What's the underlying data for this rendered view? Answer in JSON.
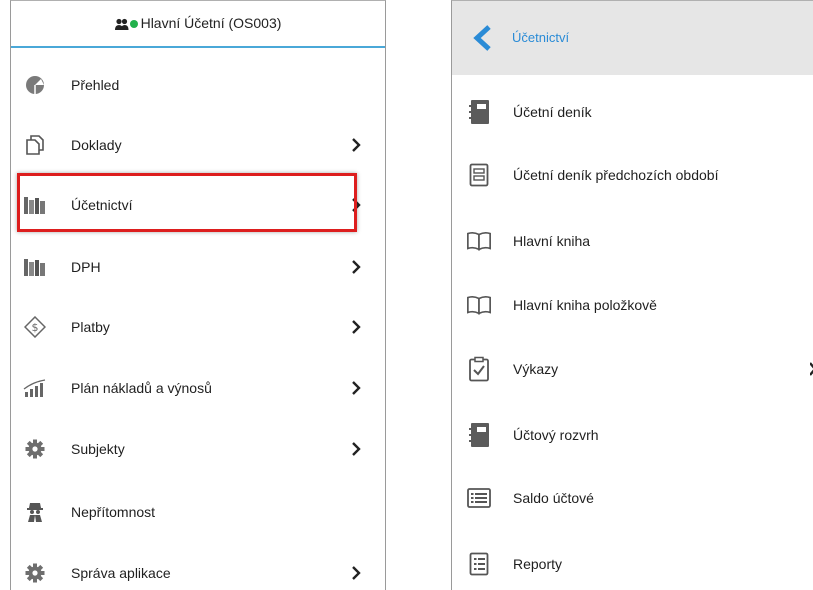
{
  "left_menu": {
    "user": {
      "name": "Hlavní Účetní (OS003)",
      "online_color": "#22b14c"
    },
    "items": [
      {
        "label": "Přehled",
        "icon": "pie-chart-icon",
        "has_submenu": false
      },
      {
        "label": "Doklady",
        "icon": "documents-icon",
        "has_submenu": true
      },
      {
        "label": "Účetnictví",
        "icon": "books-icon",
        "has_submenu": true,
        "highlighted": true
      },
      {
        "label": "DPH",
        "icon": "books-icon",
        "has_submenu": true
      },
      {
        "label": "Platby",
        "icon": "payment-icon",
        "has_submenu": true
      },
      {
        "label": "Plán nákladů a výnosů",
        "icon": "growth-chart-icon",
        "has_submenu": true
      },
      {
        "label": "Subjekty",
        "icon": "gear-icon",
        "has_submenu": true
      },
      {
        "label": "Nepřítomnost",
        "icon": "spy-icon",
        "has_submenu": false
      },
      {
        "label": "Správa aplikace",
        "icon": "gear-icon",
        "has_submenu": true
      }
    ]
  },
  "right_menu": {
    "title": "Účetnictví",
    "items": [
      {
        "label": "Účetní deník",
        "icon": "journal-icon"
      },
      {
        "label": "Účetní deník předchozích období",
        "icon": "archive-journal-icon"
      },
      {
        "label": "Hlavní kniha",
        "icon": "open-book-icon"
      },
      {
        "label": "Hlavní kniha položkově",
        "icon": "open-book-icon"
      },
      {
        "label": "Výkazy",
        "icon": "clipboard-check-icon",
        "has_submenu": true
      },
      {
        "label": "Účtový rozvrh",
        "icon": "journal-icon"
      },
      {
        "label": "Saldo účtové",
        "icon": "list-icon"
      },
      {
        "label": "Reporty",
        "icon": "report-icon"
      }
    ]
  },
  "colors": {
    "accent": "#4aa8d8",
    "link": "#2a8bd6",
    "highlight_border": "#dd1e1e"
  }
}
